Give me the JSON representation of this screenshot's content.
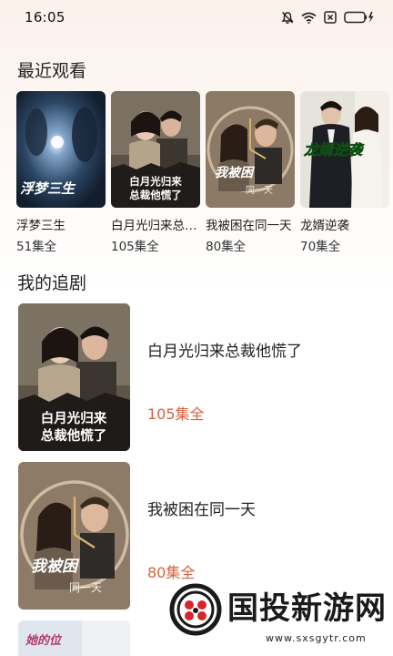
{
  "status_bar": {
    "time": "16:05",
    "icons": [
      "mute-icon",
      "wifi-icon",
      "sim-off-icon",
      "battery-charging-icon"
    ]
  },
  "recent": {
    "title": "最近观看",
    "items": [
      {
        "name": "浮梦三生",
        "count": "51集全"
      },
      {
        "name": "白月光归来总裁他慌了",
        "count": "105集全"
      },
      {
        "name": "我被困在同一天",
        "count": "80集全"
      },
      {
        "name": "龙婿逆袭",
        "count": "70集全"
      }
    ]
  },
  "follow": {
    "title": "我的追剧",
    "items": [
      {
        "title": "白月光归来总裁他慌了",
        "count": "105集全"
      },
      {
        "title": "我被困在同一天",
        "count": "80集全"
      }
    ]
  },
  "posters": {
    "p1": "浮梦三生",
    "p2": [
      "白月光归来",
      "总裁他慌了"
    ],
    "p3": "我被困",
    "p3b": "同一天",
    "p4": "龙婿逆袭",
    "p5": "她的位"
  },
  "watermark": {
    "text": "国投新游网",
    "url": "www.sxsgytr.com"
  },
  "colors": {
    "accent": "#d9603a",
    "background_top": "#fbf1ec"
  }
}
